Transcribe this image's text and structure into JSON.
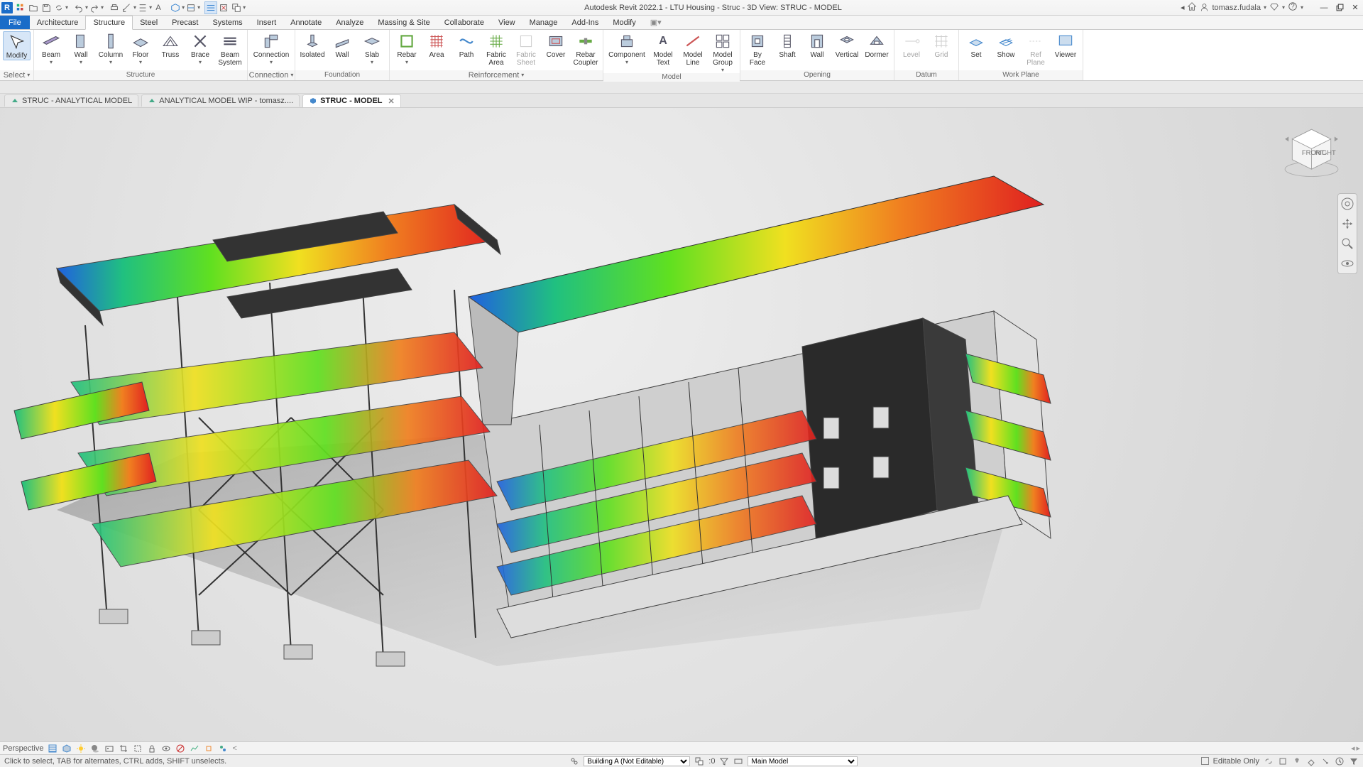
{
  "title": "Autodesk Revit 2022.1 - LTU Housing - Struc - 3D View: STRUC - MODEL",
  "user": "tomasz.fudala",
  "tabs": [
    "Architecture",
    "Structure",
    "Steel",
    "Precast",
    "Systems",
    "Insert",
    "Annotate",
    "Analyze",
    "Massing & Site",
    "Collaborate",
    "View",
    "Manage",
    "Add-Ins",
    "Modify"
  ],
  "active_tab": "Structure",
  "file_tab": "File",
  "panels": {
    "select": {
      "modify": "Modify",
      "title": "Select"
    },
    "structure": {
      "beam": "Beam",
      "wall": "Wall",
      "column": "Column",
      "floor": "Floor",
      "truss": "Truss",
      "brace": "Brace",
      "beamsys": "Beam\nSystem",
      "title": "Structure"
    },
    "connection": {
      "connection": "Connection",
      "title": "Connection"
    },
    "foundation": {
      "isolated": "Isolated",
      "wall": "Wall",
      "slab": "Slab",
      "title": "Foundation"
    },
    "reinforcement": {
      "rebar": "Rebar",
      "area": "Area",
      "path": "Path",
      "fabricarea": "Fabric\nArea",
      "fabricsheet": "Fabric\nSheet",
      "cover": "Cover",
      "rebarcoupler": "Rebar\nCoupler",
      "title": "Reinforcement"
    },
    "model": {
      "component": "Component",
      "modeltext": "Model\nText",
      "modelline": "Model\nLine",
      "modelgroup": "Model\nGroup",
      "title": "Model"
    },
    "opening": {
      "byface": "By\nFace",
      "shaft": "Shaft",
      "wall": "Wall",
      "vertical": "Vertical",
      "dormer": "Dormer",
      "title": "Opening"
    },
    "datum": {
      "level": "Level",
      "grid": "Grid",
      "title": "Datum"
    },
    "workplane": {
      "set": "Set",
      "show": "Show",
      "refplane": "Ref\nPlane",
      "viewer": "Viewer",
      "title": "Work Plane"
    }
  },
  "view_tabs": [
    {
      "label": "STRUC - ANALYTICAL MODEL",
      "active": false
    },
    {
      "label": "ANALYTICAL MODEL WIP - tomasz....",
      "active": false
    },
    {
      "label": "STRUC - MODEL",
      "active": true
    }
  ],
  "vcb": {
    "persp": "Perspective"
  },
  "status": {
    "hint": "Click to select, TAB for alternates, CTRL adds, SHIFT unselects.",
    "workset": "Building A (Not Editable)",
    "sel": ":0",
    "phase": "Main Model",
    "editable": "Editable Only"
  },
  "viewcube": {
    "front": "FRONT",
    "right": "RIGHT"
  }
}
